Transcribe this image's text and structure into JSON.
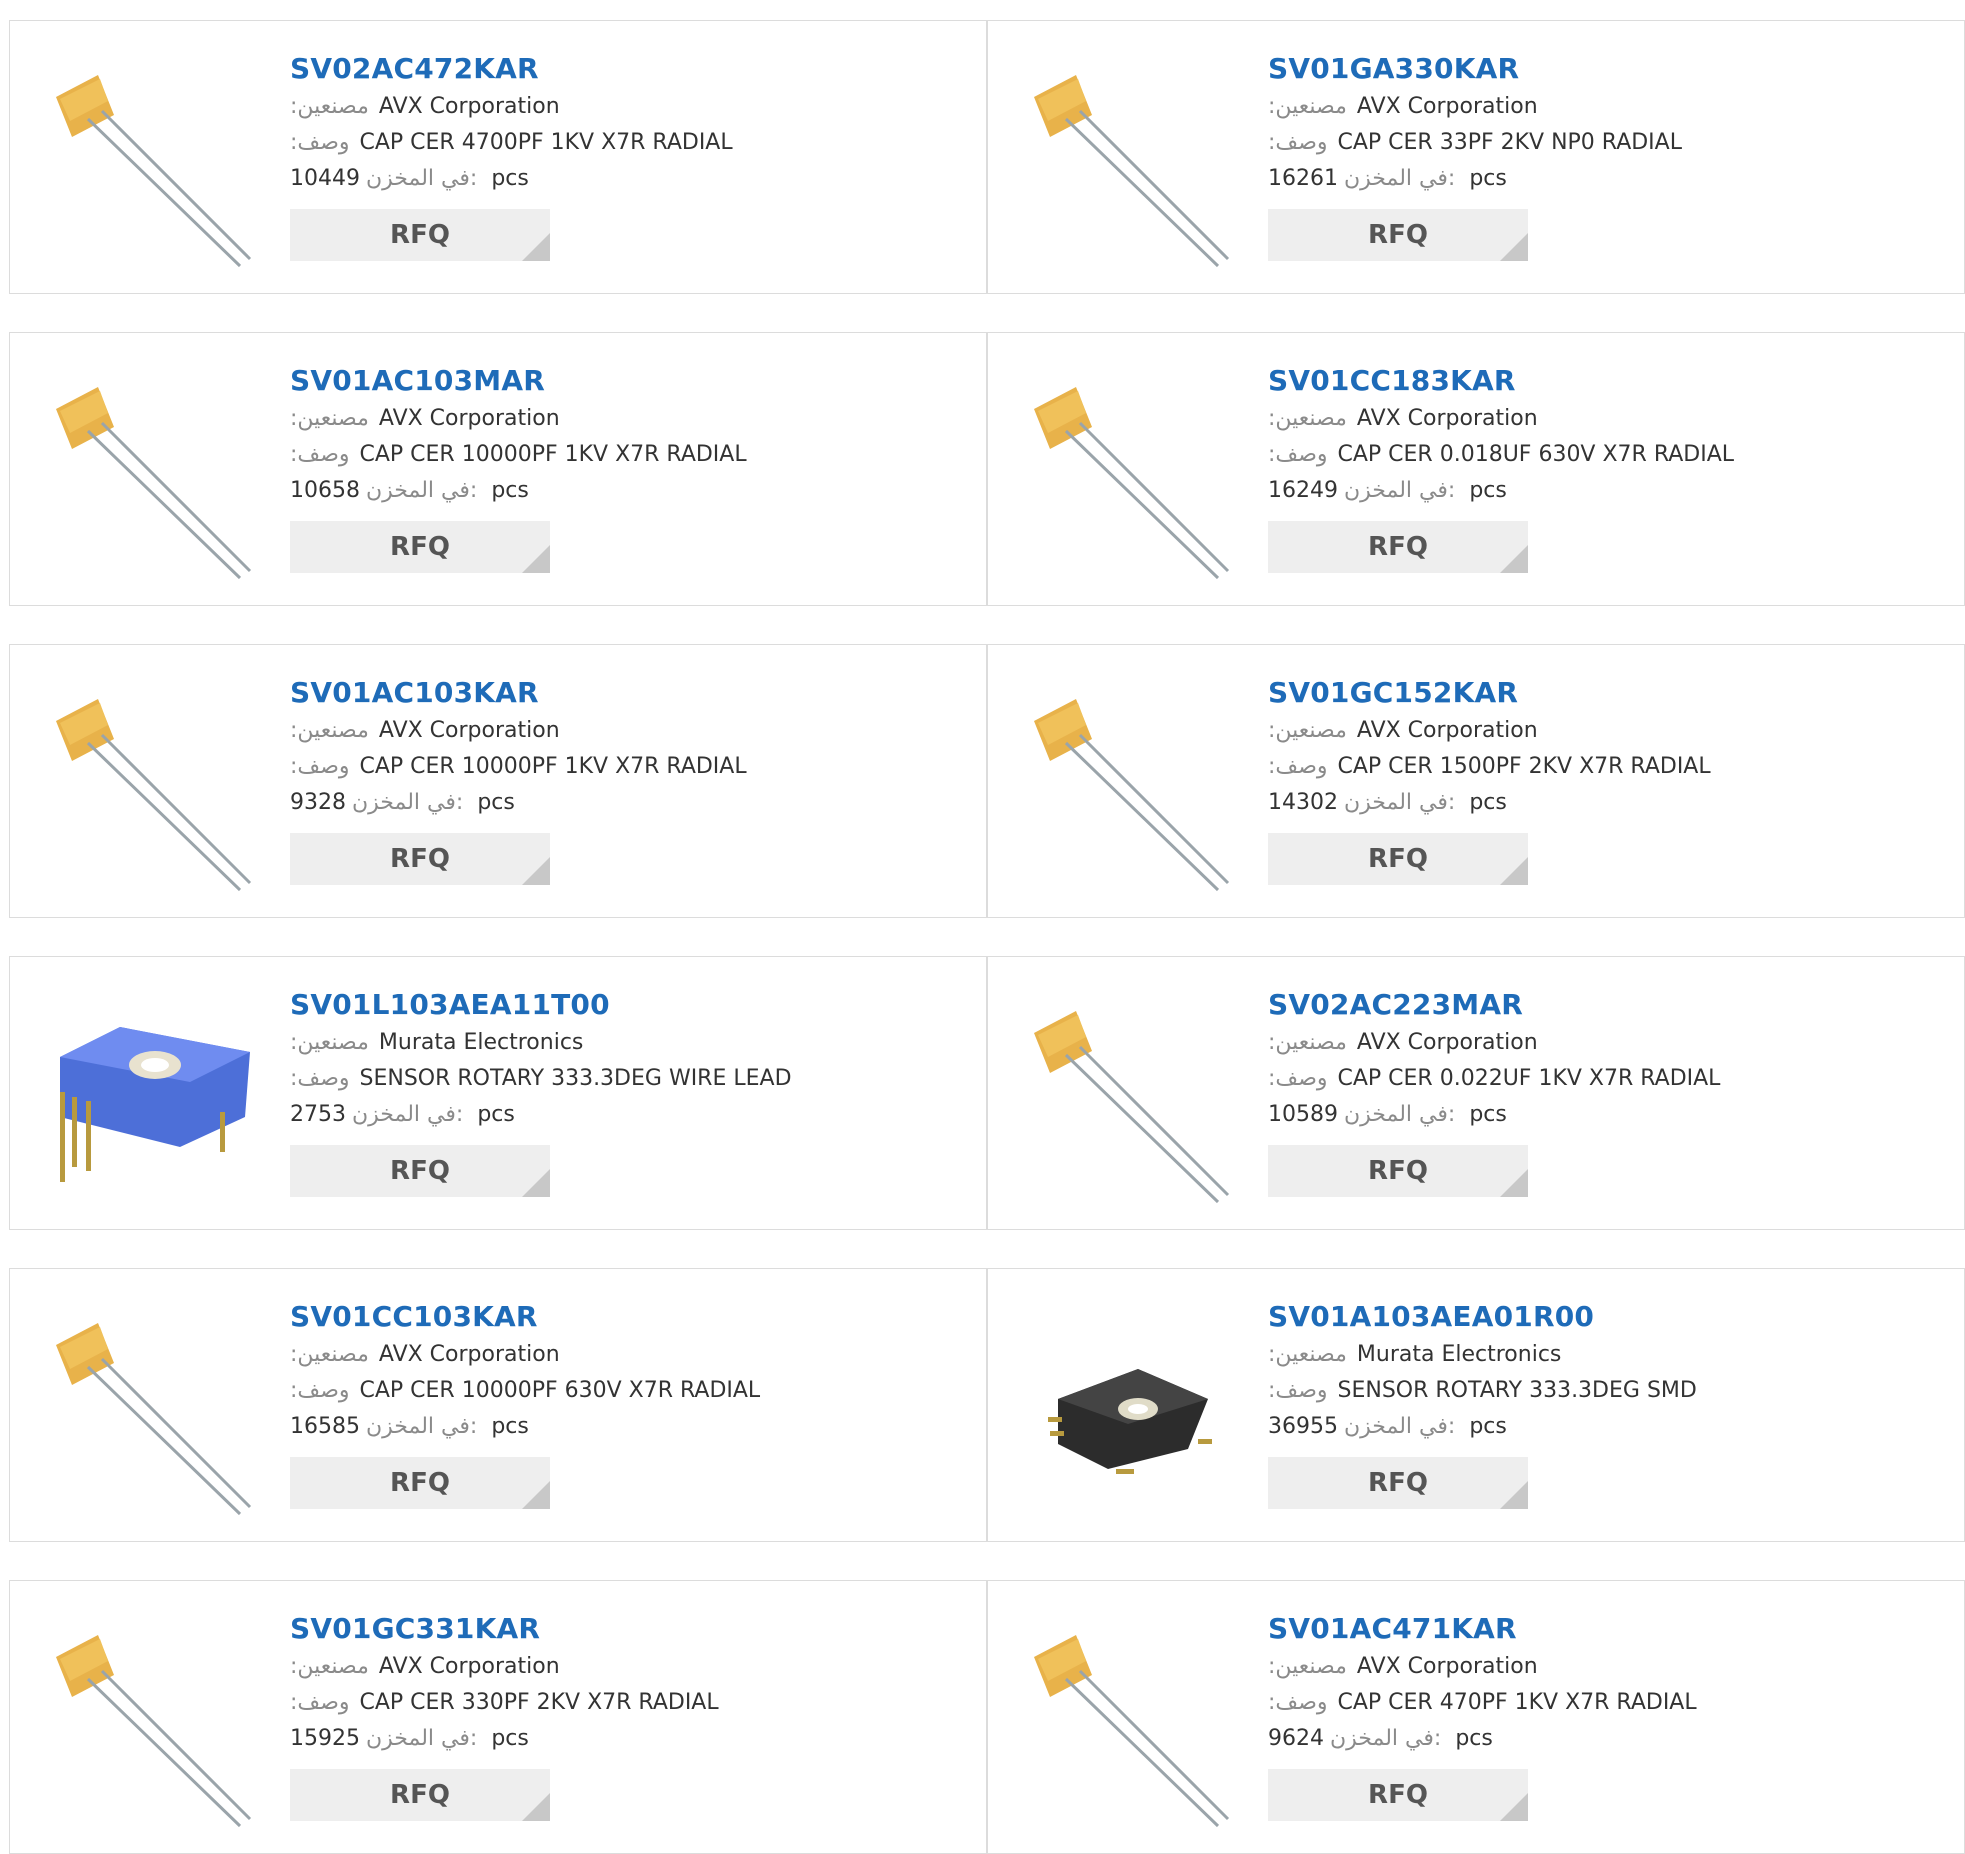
{
  "labels": {
    "manufacturer": ":مصنعين",
    "description": ":وصف",
    "stock": "في المخزن:",
    "unit": "pcs",
    "rfq": "RFQ"
  },
  "products": [
    {
      "part": "SV02AC472KAR",
      "manufacturer": "AVX Corporation",
      "description": "CAP CER 4700PF 1KV X7R RADIAL",
      "stock": "10449",
      "image": "capacitor"
    },
    {
      "part": "SV01GA330KAR",
      "manufacturer": "AVX Corporation",
      "description": "CAP CER 33PF 2KV NP0 RADIAL",
      "stock": "16261",
      "image": "capacitor"
    },
    {
      "part": "SV01AC103MAR",
      "manufacturer": "AVX Corporation",
      "description": "CAP CER 10000PF 1KV X7R RADIAL",
      "stock": "10658",
      "image": "capacitor"
    },
    {
      "part": "SV01CC183KAR",
      "manufacturer": "AVX Corporation",
      "description": "CAP CER 0.018UF 630V X7R RADIAL",
      "stock": "16249",
      "image": "capacitor"
    },
    {
      "part": "SV01AC103KAR",
      "manufacturer": "AVX Corporation",
      "description": "CAP CER 10000PF 1KV X7R RADIAL",
      "stock": "9328",
      "image": "capacitor"
    },
    {
      "part": "SV01GC152KAR",
      "manufacturer": "AVX Corporation",
      "description": "CAP CER 1500PF 2KV X7R RADIAL",
      "stock": "14302",
      "image": "capacitor"
    },
    {
      "part": "SV01L103AEA11T00",
      "manufacturer": "Murata Electronics",
      "description": "SENSOR ROTARY 333.3DEG WIRE LEAD",
      "stock": "2753",
      "image": "rotary-sensor-blue"
    },
    {
      "part": "SV02AC223MAR",
      "manufacturer": "AVX Corporation",
      "description": "CAP CER 0.022UF 1KV X7R RADIAL",
      "stock": "10589",
      "image": "capacitor"
    },
    {
      "part": "SV01CC103KAR",
      "manufacturer": "AVX Corporation",
      "description": "CAP CER 10000PF 630V X7R RADIAL",
      "stock": "16585",
      "image": "capacitor"
    },
    {
      "part": "SV01A103AEA01R00",
      "manufacturer": "Murata Electronics",
      "description": "SENSOR ROTARY 333.3DEG SMD",
      "stock": "36955",
      "image": "rotary-sensor-black"
    },
    {
      "part": "SV01GC331KAR",
      "manufacturer": "AVX Corporation",
      "description": "CAP CER 330PF 2KV X7R RADIAL",
      "stock": "15925",
      "image": "capacitor"
    },
    {
      "part": "SV01AC471KAR",
      "manufacturer": "AVX Corporation",
      "description": "CAP CER 470PF 1KV X7R RADIAL",
      "stock": "9624",
      "image": "capacitor"
    }
  ],
  "colors": {
    "part_link": "#1e6bb8",
    "label": "#8a8a8a",
    "rfq_bg": "#eeeeee",
    "card_border": "#dcdcdc"
  }
}
